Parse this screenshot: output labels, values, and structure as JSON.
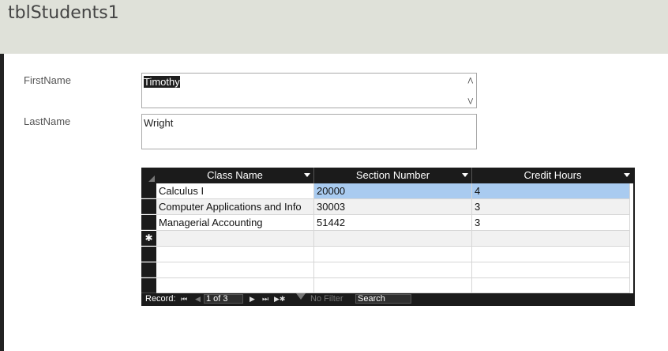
{
  "form": {
    "title": "tblStudents1"
  },
  "fields": {
    "first_name": {
      "label": "FirstName",
      "value": "Timothy"
    },
    "last_name": {
      "label": "LastName",
      "value": "Wright"
    }
  },
  "subform": {
    "columns": [
      "Class Name",
      "Section Number",
      "Credit Hours"
    ],
    "rows": [
      [
        "Calculus I",
        "20000",
        "4"
      ],
      [
        "Computer Applications and Info",
        "30003",
        "3"
      ],
      [
        "Managerial Accounting",
        "51442",
        "3"
      ]
    ],
    "new_row_marker": "✱"
  },
  "navigation": {
    "record_label": "Record:",
    "first": "⏮",
    "prev": "◀",
    "current": "1 of 3",
    "next": "▶",
    "last": "⏭",
    "new": "▶✱",
    "filter_label": "No Filter",
    "search_label": "Search"
  }
}
